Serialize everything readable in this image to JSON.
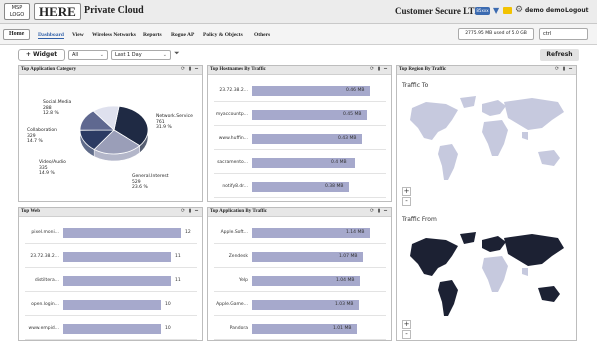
{
  "header": {
    "msp_logo": "MSP LOGO",
    "here_logo": "HERE",
    "title": "Private Cloud",
    "customer": "Customer Secure LTD",
    "alert_badge": "85xxx",
    "user": "demo demo",
    "logout": "Logout"
  },
  "nav": {
    "home": "Home",
    "tabs": [
      "Dashboard",
      "View",
      "Wireless Networks",
      "Reports",
      "Rogue AP",
      "Policy & Objects",
      "Others"
    ],
    "active_tab": "Dashboard",
    "quota": "2775.95 MB used of 5.0 GB",
    "search_value": "ctrl"
  },
  "toolbar": {
    "widget_button": "+ Widget",
    "filter_all": "All",
    "time_range": "Last 1 Day",
    "refresh": "Refresh"
  },
  "panels": {
    "app_category": {
      "title": "Top Application Category",
      "slices": [
        {
          "name": "Network.Service",
          "value": "761",
          "pct": "31.9 %",
          "amount": 761,
          "color": "#1f2a44"
        },
        {
          "name": "General.Interest",
          "value": "529",
          "pct": "23.6 %",
          "amount": 529,
          "color": "#9a9eb8"
        },
        {
          "name": "Video/Audio",
          "value": "335",
          "pct": "14.9 %",
          "amount": 335,
          "color": "#2c3b63"
        },
        {
          "name": "Collaboration",
          "value": "329",
          "pct": "14.7 %",
          "amount": 329,
          "color": "#5f6890"
        },
        {
          "name": "Social.Media",
          "value": "288",
          "pct": "12.8 %",
          "amount": 288,
          "color": "#dfe1ee"
        }
      ]
    },
    "hostnames": {
      "title": "Top Hostnames By Traffic",
      "rows": [
        {
          "label": "23.72.38.2...",
          "value": "0.46 MB",
          "amount": 0.46
        },
        {
          "label": "myaccountp...",
          "value": "0.45 MB",
          "amount": 0.45
        },
        {
          "label": "www.huffin...",
          "value": "0.43 MB",
          "amount": 0.43
        },
        {
          "label": "sacramento...",
          "value": "0.4 MB",
          "amount": 0.4
        },
        {
          "label": "notify8.dr...",
          "value": "0.38 MB",
          "amount": 0.38
        }
      ]
    },
    "region": {
      "title": "Top Region By Traffic",
      "traffic_to": "Traffic To",
      "traffic_from": "Traffic From",
      "zoom_in": "+",
      "zoom_out": "-"
    },
    "web": {
      "title": "Top Web",
      "rows": [
        {
          "label": "pixel.moni...",
          "value": "12",
          "amount": 12
        },
        {
          "label": "23.72.38.2...",
          "value": "11",
          "amount": 11
        },
        {
          "label": "distiltera...",
          "value": "11",
          "amount": 11
        },
        {
          "label": "open.login...",
          "value": "10",
          "amount": 10
        },
        {
          "label": "www.empid...",
          "value": "10",
          "amount": 10
        }
      ]
    },
    "app_traffic": {
      "title": "Top Application By Traffic",
      "rows": [
        {
          "label": "Apple.Soft...",
          "value": "1.14 MB",
          "amount": 1.14
        },
        {
          "label": "Zendesk",
          "value": "1.07 MB",
          "amount": 1.07
        },
        {
          "label": "Yelp",
          "value": "1.04 MB",
          "amount": 1.04
        },
        {
          "label": "Apple.Game...",
          "value": "1.03 MB",
          "amount": 1.03
        },
        {
          "label": "Pandora",
          "value": "1.01 MB",
          "amount": 1.01
        }
      ]
    }
  },
  "colors": {
    "bar": "#a6a9cc",
    "map_land": "#c6c9de",
    "map_land_dark": "#1c2133",
    "accent": "#2f5fa8"
  }
}
